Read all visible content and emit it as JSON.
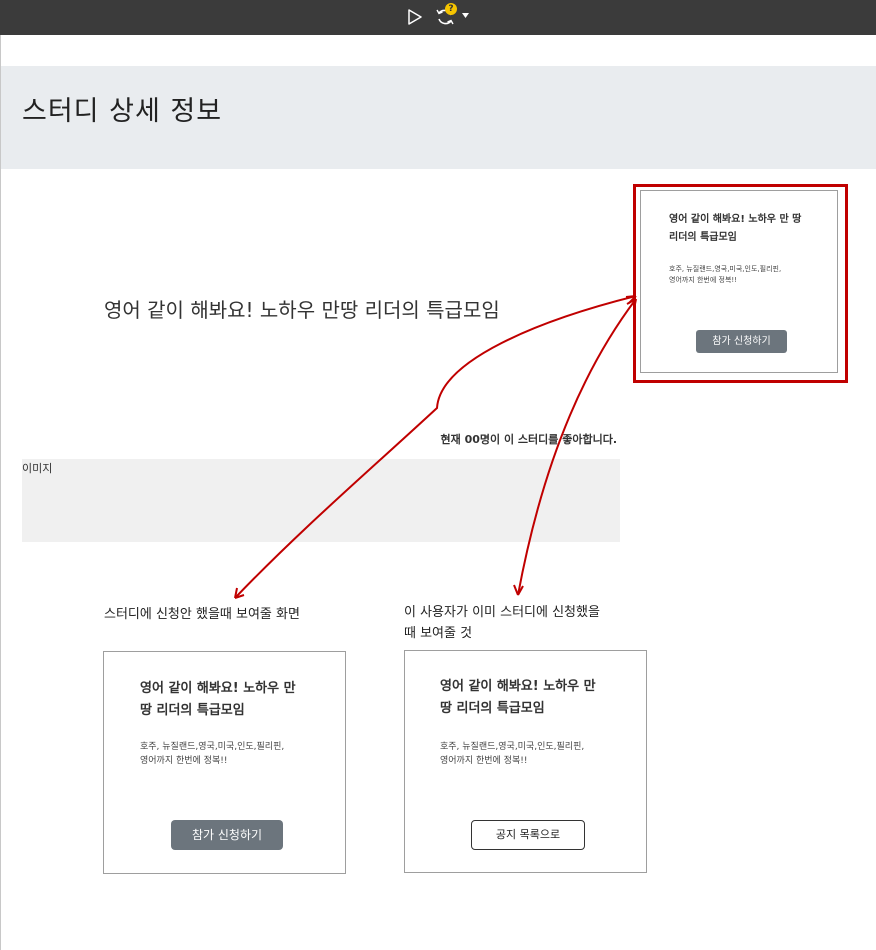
{
  "toolbar": {
    "run_icon": "play-icon",
    "sync_icon": "sync-icon",
    "help_badge": "?",
    "menu_icon": "chevron-down-icon"
  },
  "header": {
    "title": "스터디 상세 정보"
  },
  "study": {
    "title": "영어 같이 해봐요! 노하우 만땅 리더의 특급모임",
    "likes_text": "현재 00명이 이 스터디를 좋아합니다.",
    "image_label": "이미지"
  },
  "preview_card": {
    "title": "영어 같이 해봐요! 노하우 만 땅 리더의 특급모임",
    "desc_line1": "호주, 뉴질랜드,영국,미국,인도,필리핀,",
    "desc_line2": "영어까지 한번에 정복!!",
    "button_label": "참가 신청하기"
  },
  "state_not_applied": {
    "caption": "스터디에 신청안 했을때 보여줄 화면",
    "title_line1": "영어 같이 해봐요! 노하우 만",
    "title_line2": "땅 리더의 특급모임",
    "desc_line1": "호주, 뉴질랜드,영국,미국,인도,필리핀,",
    "desc_line2": "영어까지 한번에 정복!!",
    "button_label": "참가 신청하기"
  },
  "state_applied": {
    "caption_line1": "이 사용자가 이미 스터디에 신청했을",
    "caption_line2": "때 보여줄 것",
    "title_line1": "영어 같이 해봐요! 노하우 만",
    "title_line2": "땅 리더의 특급모임",
    "desc_line1": "호주, 뉴질랜드,영국,미국,인도,필리핀,",
    "desc_line2": "영어까지 한번에 정복!!",
    "button_label": "공지 목록으로"
  },
  "colors": {
    "toolbar_bg": "#3b3b3b",
    "header_bg": "#e9ecef",
    "button_dark": "#6c757d",
    "highlight_red": "#c00000",
    "help_yellow": "#f5c400"
  }
}
